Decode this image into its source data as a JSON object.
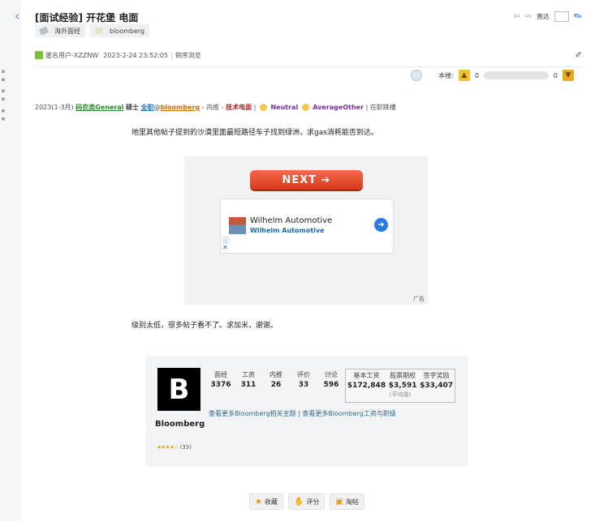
{
  "thread": {
    "title": "[面试经验] 开花堡 电面",
    "tags": [
      "海外面经",
      "bloomberg"
    ],
    "goto_label": "直达"
  },
  "meta": {
    "author": "匿名用户-XZZNW",
    "datetime": "2023-2-24 23:52:05",
    "view_mode": "倒序浏览"
  },
  "vote": {
    "floor_label": "本楼:",
    "up_count": "0",
    "down_count": "0"
  },
  "poster_line": {
    "date_range": "2023(1-3月)",
    "role": "码农类General",
    "degree": "硕士",
    "fulltime": "全职",
    "company": "bloomberg",
    "source": "内推",
    "stage": "技术电面",
    "sentiment": "Neutral",
    "difficulty": "AverageOther",
    "status": "在职跳槽",
    "sep1": "-",
    "sep2": "|",
    "at": "@"
  },
  "post": {
    "line1": "地里其他帖子提到的沙漠里面最短路径车子找到绿洲，求gas消耗能否到达。",
    "line2": "级别太低，很多帖子看不了。求加米，谢谢。"
  },
  "ad": {
    "next_label": "NEXT ➔",
    "title": "Wilhelm Automotive",
    "subtitle": "Wilhelm Automotive",
    "label": "广告"
  },
  "company_card": {
    "logo_letter": "B",
    "name": "Bloomberg",
    "rating_count": "(33)",
    "stats": [
      {
        "label": "面经",
        "value": "3376"
      },
      {
        "label": "工资",
        "value": "311"
      },
      {
        "label": "内推",
        "value": "26"
      },
      {
        "label": "评价",
        "value": "33"
      },
      {
        "label": "讨论",
        "value": "596"
      }
    ],
    "salary": [
      {
        "label": "基本工资",
        "value": "$172,848"
      },
      {
        "label": "股票期权",
        "value": "$3,591"
      },
      {
        "label": "签字奖励",
        "value": "$33,407"
      }
    ],
    "salary_note": "(平均值)",
    "link_topics": "查看更多Bloomberg相关主题",
    "link_sep": "|",
    "link_salary": "查看更多Bloomberg工资与职级"
  },
  "actions": {
    "favorite": "收藏",
    "rate": "评分",
    "taotie": "淘帖"
  }
}
